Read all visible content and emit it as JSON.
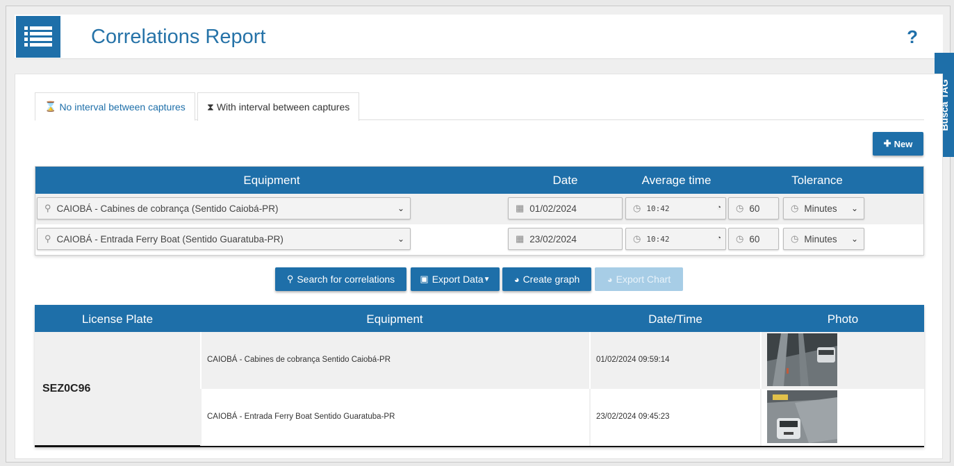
{
  "header": {
    "title": "Correlations Report",
    "help": "?"
  },
  "side_tab": "Busca TAG",
  "tabs": [
    {
      "label": "No interval between captures",
      "icon": "hourglass-empty-icon"
    },
    {
      "label": "With interval between captures",
      "icon": "hourglass-full-icon"
    }
  ],
  "new_button": "New",
  "equipment_table": {
    "headers": {
      "equipment": "Equipment",
      "date": "Date",
      "average_time": "Average time",
      "tolerance": "Tolerance"
    },
    "rows": [
      {
        "equipment": "CAIOBÁ - Cabines de cobrança (Sentido Caiobá-PR)",
        "date": "01/02/2024",
        "time": "10:42",
        "tolerance": "60",
        "unit": "Minutes"
      },
      {
        "equipment": "CAIOBÁ - Entrada Ferry Boat (Sentido Guaratuba-PR)",
        "date": "23/02/2024",
        "time": "10:42",
        "tolerance": "60",
        "unit": "Minutes"
      }
    ]
  },
  "actions": {
    "search": "Search for correlations",
    "export_data": "Export Data",
    "create_graph": "Create graph",
    "export_chart": "Export Chart"
  },
  "results": {
    "headers": {
      "plate": "License Plate",
      "equipment": "Equipment",
      "datetime": "Date/Time",
      "photo": "Photo"
    },
    "plate": "SEZ0C96",
    "rows": [
      {
        "equipment": "CAIOBÁ - Cabines de cobrança Sentido Caiobá-PR",
        "datetime": "01/02/2024 09:59:14"
      },
      {
        "equipment": "CAIOBÁ - Entrada Ferry Boat Sentido Guaratuba-PR",
        "datetime": "23/02/2024 09:45:23"
      }
    ]
  },
  "colors": {
    "primary": "#1e6fa9",
    "title": "#2673a8",
    "disabled": "#a7cde6"
  }
}
